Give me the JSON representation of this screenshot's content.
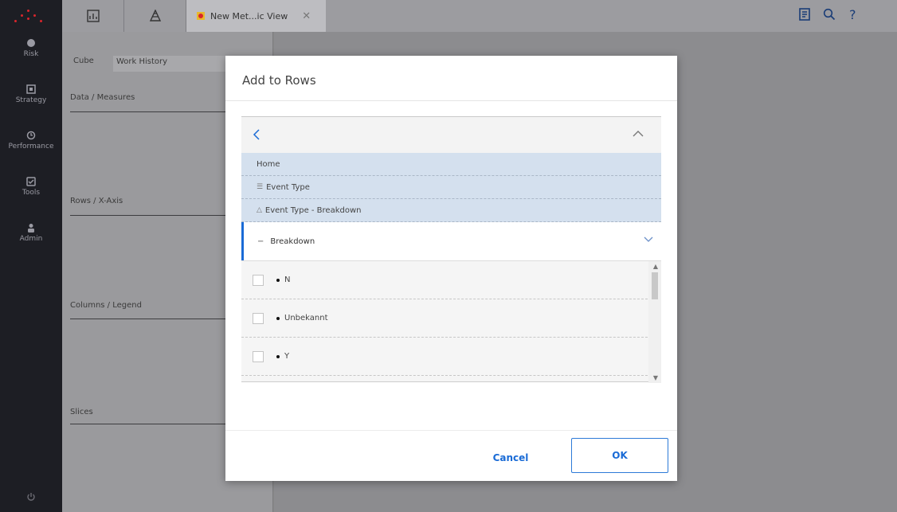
{
  "nav": {
    "items": [
      {
        "label": "Risk",
        "icon": "risk-icon"
      },
      {
        "label": "Strategy",
        "icon": "strategy-icon"
      },
      {
        "label": "Performance",
        "icon": "performance-icon"
      },
      {
        "label": "Tools",
        "icon": "tools-icon"
      },
      {
        "label": "Admin",
        "icon": "admin-icon"
      }
    ],
    "bottom_icon": "power-icon"
  },
  "topbar": {
    "tab_label": "New Met...ic View",
    "close_glyph": "✕",
    "right_icons": [
      "report-icon",
      "search-icon",
      "help-icon"
    ]
  },
  "left_panel": {
    "cube_label": "Cube",
    "cube_value": "Work History",
    "data_measures": "Data / Measures",
    "rows_axis": "Rows / X-Axis",
    "columns_legend": "Columns / Legend",
    "slices": "Slices"
  },
  "dialog": {
    "title": "Add to Rows",
    "breadcrumbs": [
      {
        "label": "Home",
        "icon": ""
      },
      {
        "label": "Event Type",
        "icon": "hierarchy-icon"
      },
      {
        "label": "Event Type - Breakdown",
        "icon": "level-icon"
      }
    ],
    "level": {
      "label": "Breakdown"
    },
    "members": [
      {
        "label": "N",
        "checked": false
      },
      {
        "label": "Unbekannt",
        "checked": false
      },
      {
        "label": "Y",
        "checked": false
      }
    ],
    "cancel_label": "Cancel",
    "ok_label": "OK",
    "accent_color": "#1a6bd6"
  }
}
